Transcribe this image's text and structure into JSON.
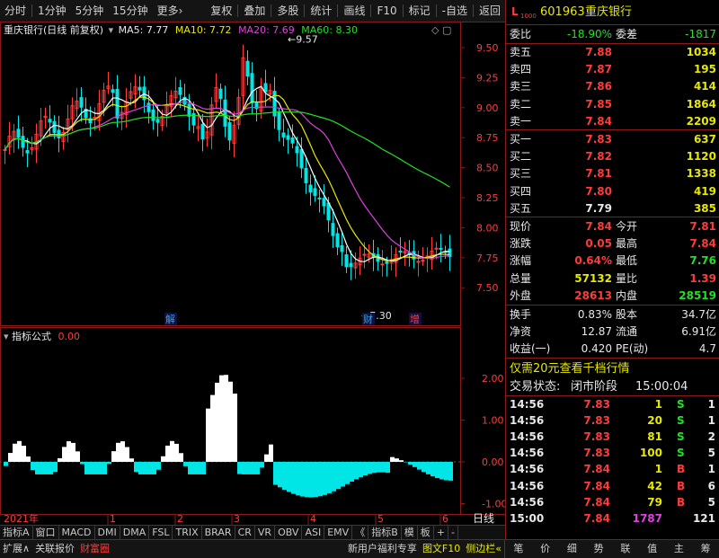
{
  "toolbar": {
    "left_items": [
      "分时",
      "1分钟",
      "5分钟",
      "15分钟",
      "更多›"
    ],
    "right_items": [
      "复权",
      "叠加",
      "多股",
      "统计",
      "画线",
      "F10",
      "标记",
      "-自选",
      "返回"
    ]
  },
  "chart_header": {
    "title": "重庆银行(日线 前复权)",
    "ma5_label": "MA5: 7.77",
    "ma10_label": "MA10: 7.72",
    "ma20_label": "MA20: 7.69",
    "ma60_label": "MA60: 8.30"
  },
  "price_axis": {
    "ticks": [
      "9.50",
      "9.25",
      "9.00",
      "8.75",
      "8.50",
      "8.25",
      "8.00",
      "7.75",
      "7.50"
    ],
    "high_label": "9.57",
    "low_label": "7.30"
  },
  "event_markers": [
    "解",
    "财",
    "增"
  ],
  "indicator": {
    "title": "指标公式",
    "value": "0.00",
    "ticks": [
      "2.00",
      "1.00",
      "0.00",
      "-1.00",
      "-2.00"
    ]
  },
  "time_axis": {
    "year_label": "2021年",
    "months": [
      "1",
      "2",
      "3",
      "4",
      "5",
      "6"
    ],
    "period": "日线"
  },
  "indicator_tabs": [
    "指标A",
    "窗口",
    "MACD",
    "DMI",
    "DMA",
    "FSL",
    "TRIX",
    "BRAR",
    "CR",
    "VR",
    "OBV",
    "ASI",
    "EMV",
    "《",
    "指标B",
    "模",
    "板",
    "+",
    "-"
  ],
  "status_bar": {
    "left": [
      "扩展∧",
      "关联报价",
      "财富圈"
    ],
    "right": [
      "新用户福利专享",
      "图文F10",
      "侧边栏«"
    ],
    "panel_tabs": [
      "笔",
      "价",
      "细",
      "势",
      "联",
      "值",
      "主",
      "筹"
    ]
  },
  "quote": {
    "code": "601963",
    "name": "重庆银行",
    "weibi_label": "委比",
    "weibi": "-18.90%",
    "weicha_label": "委差",
    "weicha": "-1817",
    "asks": [
      {
        "label": "卖五",
        "price": "7.88",
        "vol": "1034"
      },
      {
        "label": "卖四",
        "price": "7.87",
        "vol": "195"
      },
      {
        "label": "卖三",
        "price": "7.86",
        "vol": "414"
      },
      {
        "label": "卖二",
        "price": "7.85",
        "vol": "1864"
      },
      {
        "label": "卖一",
        "price": "7.84",
        "vol": "2209"
      }
    ],
    "bids": [
      {
        "label": "买一",
        "price": "7.83",
        "vol": "637"
      },
      {
        "label": "买二",
        "price": "7.82",
        "vol": "1120"
      },
      {
        "label": "买三",
        "price": "7.81",
        "vol": "1338"
      },
      {
        "label": "买四",
        "price": "7.80",
        "vol": "419"
      },
      {
        "label": "买五",
        "price": "7.79",
        "vol": "385"
      }
    ],
    "stats": [
      {
        "l1": "现价",
        "v1": "7.84",
        "c1": "red",
        "l2": "今开",
        "v2": "7.81",
        "c2": "red"
      },
      {
        "l1": "涨跌",
        "v1": "0.05",
        "c1": "red",
        "l2": "最高",
        "v2": "7.84",
        "c2": "red"
      },
      {
        "l1": "涨幅",
        "v1": "0.64%",
        "c1": "red",
        "l2": "最低",
        "v2": "7.76",
        "c2": "green"
      },
      {
        "l1": "总量",
        "v1": "57132",
        "c1": "yellow",
        "l2": "量比",
        "v2": "1.39",
        "c2": "red"
      },
      {
        "l1": "外盘",
        "v1": "28613",
        "c1": "red",
        "l2": "内盘",
        "v2": "28519",
        "c2": "green"
      }
    ],
    "fund": [
      {
        "l1": "换手",
        "v1": "0.83%",
        "l2": "股本",
        "v2": "34.7亿"
      },
      {
        "l1": "净资",
        "v1": "12.87",
        "l2": "流通",
        "v2": "6.91亿"
      },
      {
        "l1": "收益(一)",
        "v1": "0.420",
        "l2": "PE(动)",
        "v2": "4.7"
      }
    ],
    "promo": "仅需20元查看千档行情",
    "trade_status_label": "交易状态:",
    "trade_status": "闭市阶段",
    "trade_time": "15:00:04",
    "ticks": [
      {
        "time": "14:56",
        "price": "7.83",
        "vol": "1",
        "side": "S",
        "n": "1"
      },
      {
        "time": "14:56",
        "price": "7.83",
        "vol": "20",
        "side": "S",
        "n": "1"
      },
      {
        "time": "14:56",
        "price": "7.83",
        "vol": "81",
        "side": "S",
        "n": "2"
      },
      {
        "time": "14:56",
        "price": "7.83",
        "vol": "100",
        "side": "S",
        "n": "5"
      },
      {
        "time": "14:56",
        "price": "7.84",
        "vol": "1",
        "side": "B",
        "n": "1"
      },
      {
        "time": "14:56",
        "price": "7.84",
        "vol": "42",
        "side": "B",
        "n": "6"
      },
      {
        "time": "14:56",
        "price": "7.84",
        "vol": "79",
        "side": "B",
        "n": "5"
      },
      {
        "time": "15:00",
        "price": "7.84",
        "vol": "1787",
        "side": "",
        "n": "121"
      }
    ]
  },
  "colors": {
    "up": "#ff3b3b",
    "down": "#22e022",
    "ma5": "#ffffff",
    "ma10": "#e8e800",
    "ma20": "#e040e0",
    "ma60": "#22e022",
    "indicator_pos": "#ffffff",
    "indicator_neg": "#00e5e5",
    "grid_border": "#8b1a1a"
  }
}
